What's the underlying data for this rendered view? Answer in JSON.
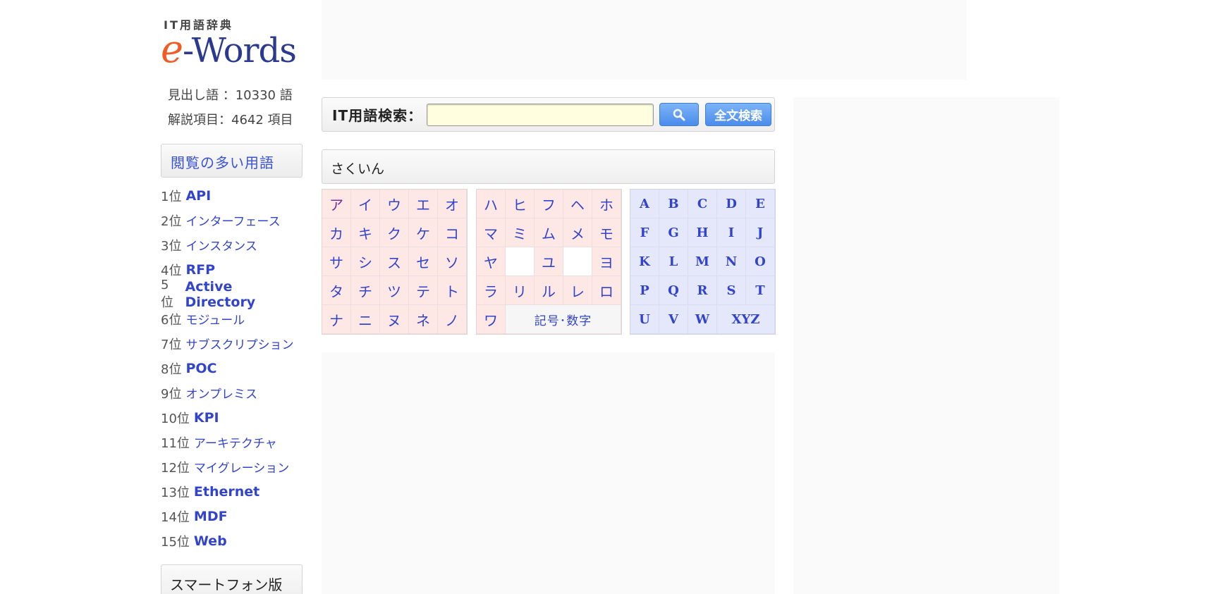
{
  "logo": {
    "top_text": "IT用語辞典",
    "main_prefix": "e",
    "main_rest": "-Words"
  },
  "stats": {
    "headwords": "見出し語 ：10330 語",
    "entries": "解説項目：4642 項目"
  },
  "popular": {
    "heading": "閲覧の多い用語",
    "items": [
      {
        "rank": "1位",
        "term": "API"
      },
      {
        "rank": "2位",
        "term": "インターフェース"
      },
      {
        "rank": "3位",
        "term": "インスタンス"
      },
      {
        "rank": "4位",
        "term": "RFP"
      },
      {
        "rank": "5位",
        "term": "Active Directory"
      },
      {
        "rank": "6位",
        "term": "モジュール"
      },
      {
        "rank": "7位",
        "term": "サブスクリプション"
      },
      {
        "rank": "8位",
        "term": "POC"
      },
      {
        "rank": "9位",
        "term": "オンプレミス"
      },
      {
        "rank": "10位",
        "term": "KPI"
      },
      {
        "rank": "11位",
        "term": "アーキテクチャ"
      },
      {
        "rank": "12位",
        "term": "マイグレーション"
      },
      {
        "rank": "13位",
        "term": "Ethernet"
      },
      {
        "rank": "14位",
        "term": "MDF"
      },
      {
        "rank": "15位",
        "term": "Web"
      }
    ]
  },
  "smartphone_label": "スマートフォン版",
  "search": {
    "label": "IT用語検索：",
    "value": "",
    "fulltext_label": "全文検索"
  },
  "index_heading": "さくいん",
  "kana_a": [
    [
      "ア",
      "イ",
      "ウ",
      "エ",
      "オ"
    ],
    [
      "カ",
      "キ",
      "ク",
      "ケ",
      "コ"
    ],
    [
      "サ",
      "シ",
      "ス",
      "セ",
      "ソ"
    ],
    [
      "タ",
      "チ",
      "ツ",
      "テ",
      "ト"
    ],
    [
      "ナ",
      "ニ",
      "ヌ",
      "ネ",
      "ノ"
    ]
  ],
  "kana_ha": [
    [
      "ハ",
      "ヒ",
      "フ",
      "ヘ",
      "ホ"
    ],
    [
      "マ",
      "ミ",
      "ム",
      "メ",
      "モ"
    ],
    [
      "ヤ",
      "",
      "ユ",
      "",
      "ヨ"
    ],
    [
      "ラ",
      "リ",
      "ル",
      "レ",
      "ロ"
    ]
  ],
  "kana_wa": "ワ",
  "symbols_label": "記号･数字",
  "latin": [
    [
      "A",
      "B",
      "C",
      "D",
      "E"
    ],
    [
      "F",
      "G",
      "H",
      "I",
      "J"
    ],
    [
      "K",
      "L",
      "M",
      "N",
      "O"
    ],
    [
      "P",
      "Q",
      "R",
      "S",
      "T"
    ],
    [
      "U",
      "V",
      "W",
      "XYZ"
    ]
  ],
  "colors": {
    "link": "#3344cc",
    "kana_bg": "#fde8e6",
    "latin_bg": "#e4e8fa",
    "button": "#4a8cec",
    "logo_accent": "#f15a24",
    "logo_main": "#2b3a8f"
  }
}
